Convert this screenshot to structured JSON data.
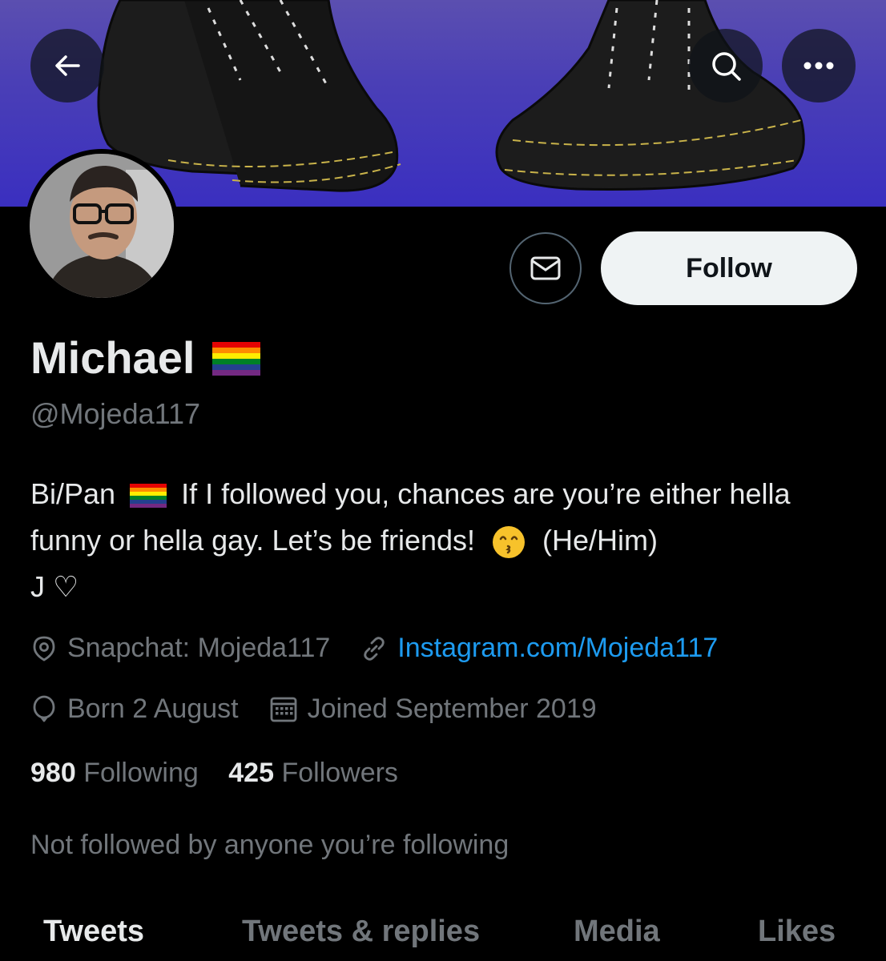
{
  "profile": {
    "name": "Michael",
    "handle": "@Mojeda117",
    "bio_part1": "Bi/Pan",
    "bio_part2": "If I followed you, chances are you’re either hella funny or hella gay. Let’s be friends!",
    "bio_part3": "(He/Him)",
    "bio_part4": "J ♡",
    "location": "Snapchat: Mojeda117",
    "website": "Instagram.com/Mojeda117",
    "birthday": "Born 2 August",
    "joined": "Joined September 2019"
  },
  "stats": {
    "following_count": "980",
    "following_label": "Following",
    "followers_count": "425",
    "followers_label": "Followers"
  },
  "social_context": "Not followed by anyone you’re following",
  "actions": {
    "follow_label": "Follow"
  },
  "tabs": [
    {
      "label": "Tweets",
      "active": true
    },
    {
      "label": "Tweets & replies",
      "active": false
    },
    {
      "label": "Media",
      "active": false
    },
    {
      "label": "Likes",
      "active": false
    }
  ],
  "icons": {
    "back": "arrow-left-icon",
    "search": "search-icon",
    "more": "more-icon",
    "message": "envelope-icon",
    "location": "location-pin-icon",
    "link": "link-icon",
    "birthday": "balloon-icon",
    "joined": "calendar-icon"
  },
  "colors": {
    "background": "#000000",
    "text": "#e7e9ea",
    "secondary_text": "#71767b",
    "link": "#1d9bf0",
    "follow_button_bg": "#eff3f4",
    "banner": "#4a3fb6"
  }
}
